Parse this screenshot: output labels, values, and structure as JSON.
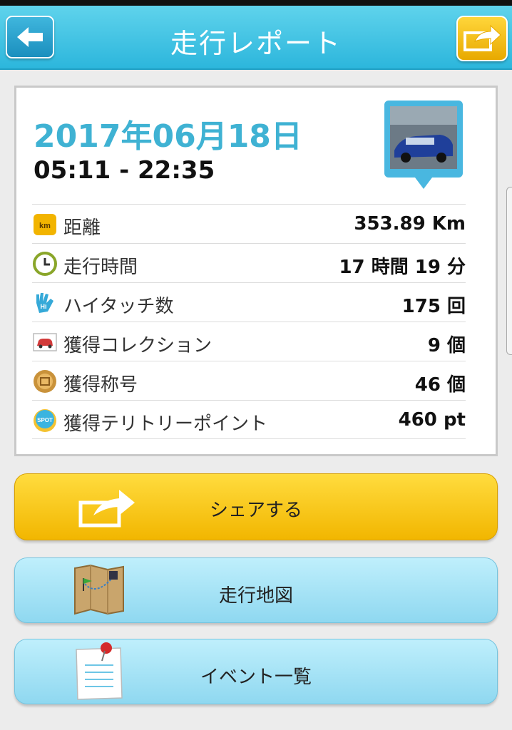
{
  "header": {
    "title": "走行レポート",
    "back_icon": "arrow-left-icon",
    "share_icon": "share-arrow-icon"
  },
  "report": {
    "date": "2017年06月18日",
    "time_range": "05:11 - 22:35",
    "car_image": "car-photo-badge"
  },
  "stats": [
    {
      "icon": "km-icon",
      "icon_text": "km",
      "label": "距離",
      "value": "353.89 Km"
    },
    {
      "icon": "clock-icon",
      "label": "走行時間",
      "value": "17 時間 19 分"
    },
    {
      "icon": "high-five-icon",
      "icon_text": "Hi",
      "label": "ハイタッチ数",
      "value": "175 回"
    },
    {
      "icon": "car-collection-icon",
      "label": "獲得コレクション",
      "value": "9 個"
    },
    {
      "icon": "title-medal-icon",
      "label": "獲得称号",
      "value": "46 個"
    },
    {
      "icon": "spot-icon",
      "icon_text": "SPOT",
      "label": "獲得テリトリーポイント",
      "value": "460 pt"
    }
  ],
  "actions": {
    "share_label": "シェアする",
    "map_label": "走行地図",
    "events_label": "イベント一覧"
  },
  "colors": {
    "header": "#2cb6dc",
    "accent_text": "#3fb2d3",
    "share_button": "#f2b600",
    "blue_button": "#8fd8f0"
  }
}
